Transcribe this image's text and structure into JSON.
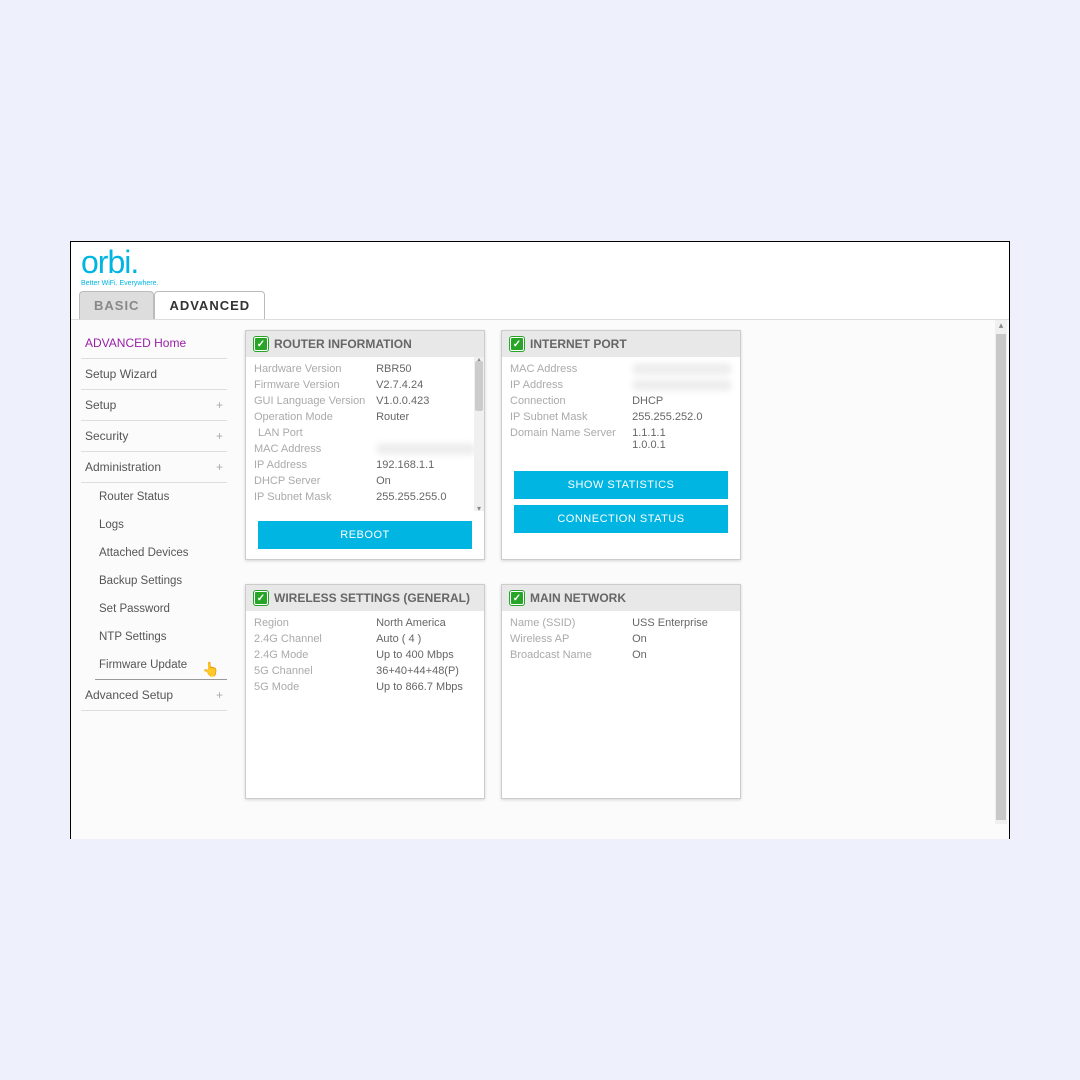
{
  "logo": {
    "text": "orbi",
    "tagline": "Better WiFi. Everywhere."
  },
  "tabs": {
    "basic": "BASIC",
    "advanced": "ADVANCED"
  },
  "sidebar": {
    "items": [
      {
        "label": "ADVANCED Home",
        "active": true
      },
      {
        "label": "Setup Wizard"
      },
      {
        "label": "Setup",
        "expandable": true
      },
      {
        "label": "Security",
        "expandable": true
      },
      {
        "label": "Administration",
        "expandable": true,
        "expanded": true
      },
      {
        "label": "Advanced Setup",
        "expandable": true
      }
    ],
    "admin_sub": [
      "Router Status",
      "Logs",
      "Attached Devices",
      "Backup Settings",
      "Set Password",
      "NTP Settings",
      "Firmware Update"
    ]
  },
  "panels": {
    "router": {
      "title": "ROUTER INFORMATION",
      "rows": [
        {
          "lbl": "Hardware Version",
          "val": "RBR50"
        },
        {
          "lbl": "Firmware Version",
          "val": "V2.7.4.24"
        },
        {
          "lbl": "GUI Language Version",
          "val": "V1.0.0.423"
        },
        {
          "lbl": "Operation Mode",
          "val": "Router"
        },
        {
          "lbl": "LAN Port",
          "val": "",
          "section": true
        },
        {
          "lbl": "MAC Address",
          "val": "",
          "blur": true
        },
        {
          "lbl": "IP Address",
          "val": "192.168.1.1"
        },
        {
          "lbl": "DHCP Server",
          "val": "On"
        },
        {
          "lbl": "IP Subnet Mask",
          "val": "255.255.255.0"
        }
      ],
      "button": "REBOOT"
    },
    "internet": {
      "title": "INTERNET PORT",
      "rows": [
        {
          "lbl": "MAC Address",
          "val": "",
          "blur": true
        },
        {
          "lbl": "IP Address",
          "val": "",
          "blur": true
        },
        {
          "lbl": "Connection",
          "val": "DHCP"
        },
        {
          "lbl": "IP Subnet Mask",
          "val": "255.255.252.0"
        },
        {
          "lbl": "Domain Name Server",
          "val": "1.1.1.1\n1.0.0.1"
        }
      ],
      "button1": "SHOW STATISTICS",
      "button2": "CONNECTION STATUS"
    },
    "wireless": {
      "title": "WIRELESS SETTINGS (GENERAL)",
      "rows": [
        {
          "lbl": "Region",
          "val": "North America"
        },
        {
          "lbl": "2.4G Channel",
          "val": "Auto ( 4 )"
        },
        {
          "lbl": "2.4G Mode",
          "val": "Up to 400 Mbps"
        },
        {
          "lbl": "5G Channel",
          "val": "36+40+44+48(P)"
        },
        {
          "lbl": "5G Mode",
          "val": "Up to 866.7 Mbps"
        }
      ]
    },
    "mainnet": {
      "title": "MAIN NETWORK",
      "rows": [
        {
          "lbl": "Name (SSID)",
          "val": "USS Enterprise"
        },
        {
          "lbl": "Wireless AP",
          "val": "On"
        },
        {
          "lbl": "Broadcast Name",
          "val": "On"
        }
      ]
    }
  }
}
